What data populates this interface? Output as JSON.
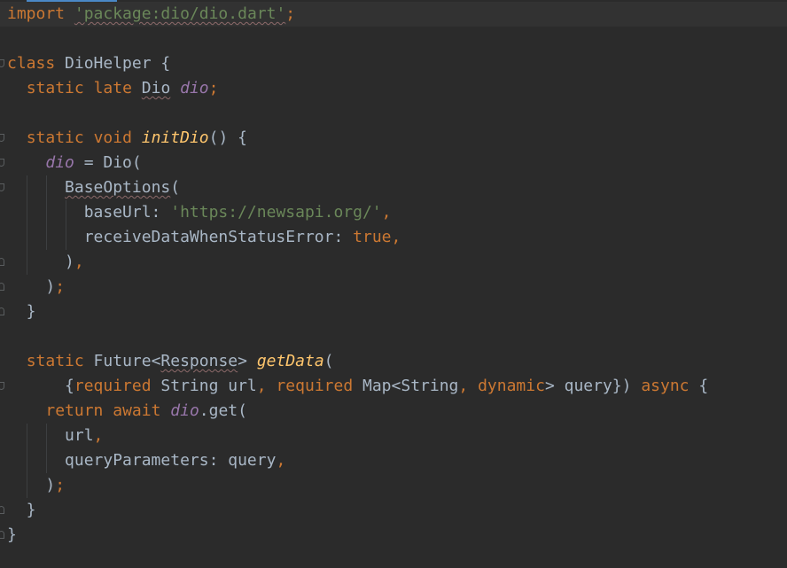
{
  "editor": {
    "language": "dart",
    "colors": {
      "background": "#2b2b2b",
      "keyword": "#cc7832",
      "string": "#6a8759",
      "field": "#9876aa",
      "function": "#ffc66d",
      "default": "#a9b7c6"
    },
    "lines": [
      "import 'package:dio/dio.dart';",
      "",
      "class DioHelper {",
      "  static late Dio dio;",
      "",
      "  static void initDio() {",
      "    dio = Dio(",
      "      BaseOptions(",
      "        baseUrl: 'https://newsapi.org/',",
      "        receiveDataWhenStatusError: true,",
      "      ),",
      "    );",
      "  }",
      "",
      "  static Future<Response> getData(",
      "      {required String url, required Map<String, dynamic> query}) async {",
      "    return await dio.get(",
      "      url,",
      "      queryParameters: query,",
      "    );",
      "  }",
      "}"
    ]
  }
}
